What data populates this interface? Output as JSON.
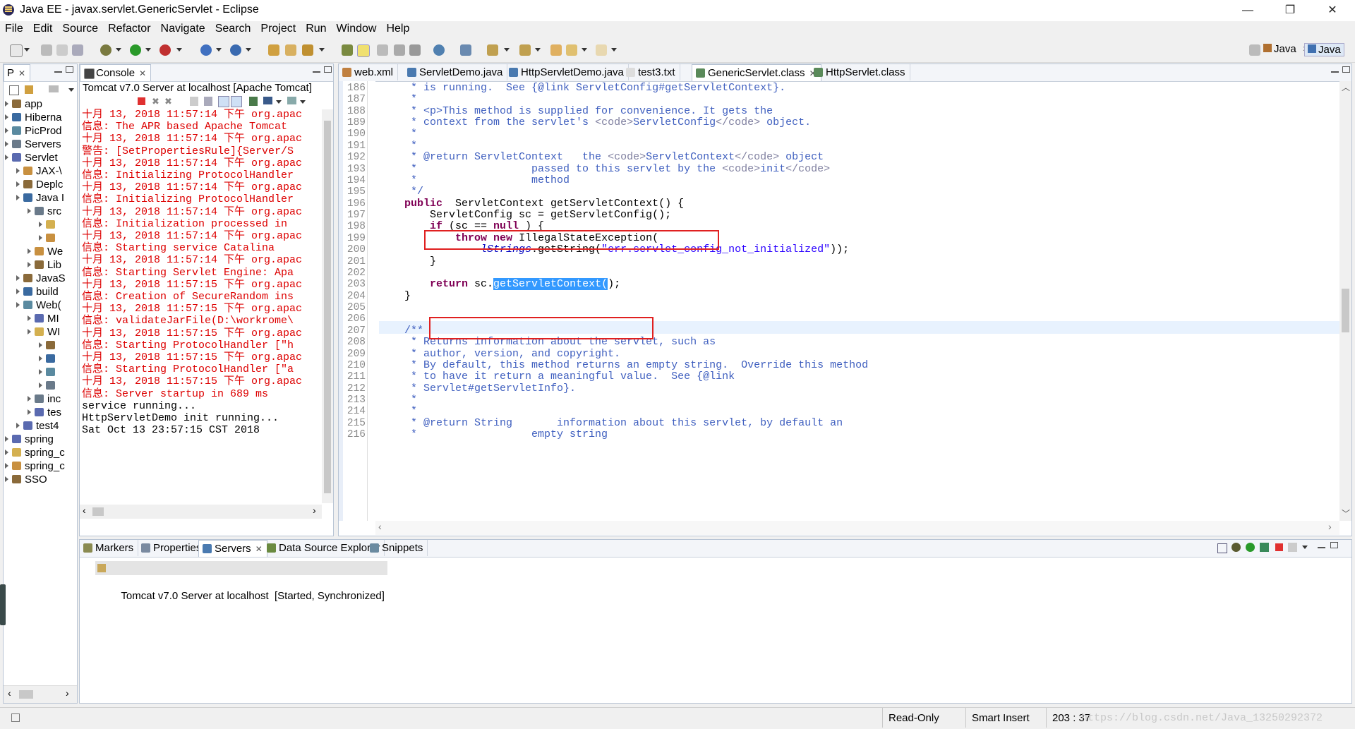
{
  "window": {
    "title": "Java EE - javax.servlet.GenericServlet - Eclipse",
    "min": "—",
    "max": "❐",
    "close": "✕"
  },
  "menu": [
    "File",
    "Edit",
    "Source",
    "Refactor",
    "Navigate",
    "Search",
    "Project",
    "Run",
    "Window",
    "Help"
  ],
  "perspectives": {
    "java": "Java",
    "java_active": "Java"
  },
  "project_explorer": {
    "tab": "P",
    "items": [
      {
        "label": "app",
        "level": 0
      },
      {
        "label": "Hiberna",
        "level": 0
      },
      {
        "label": "PicProd",
        "level": 0
      },
      {
        "label": "Servers",
        "level": 0
      },
      {
        "label": "Servlet",
        "level": 0
      },
      {
        "label": "JAX-\\",
        "level": 1
      },
      {
        "label": "Deplc",
        "level": 1
      },
      {
        "label": "Java I",
        "level": 1
      },
      {
        "label": "src",
        "level": 2
      },
      {
        "label": "",
        "level": 3
      },
      {
        "label": "",
        "level": 3
      },
      {
        "label": "We",
        "level": 2
      },
      {
        "label": "Lib",
        "level": 2
      },
      {
        "label": "JavaS",
        "level": 1
      },
      {
        "label": "build",
        "level": 1
      },
      {
        "label": "Web(",
        "level": 1
      },
      {
        "label": "MI",
        "level": 2
      },
      {
        "label": "WI",
        "level": 2
      },
      {
        "label": "",
        "level": 3
      },
      {
        "label": "",
        "level": 3
      },
      {
        "label": "",
        "level": 3
      },
      {
        "label": "",
        "level": 3
      },
      {
        "label": "inc",
        "level": 2
      },
      {
        "label": "tes",
        "level": 2
      },
      {
        "label": "test4",
        "level": 1
      },
      {
        "label": "spring",
        "level": 0
      },
      {
        "label": "spring_c",
        "level": 0
      },
      {
        "label": "spring_c",
        "level": 0
      },
      {
        "label": "SSO",
        "level": 0
      }
    ]
  },
  "console": {
    "tab": "Console",
    "header": "Tomcat v7.0 Server at localhost [Apache Tomcat]",
    "lines": [
      {
        "t": "十月 13, 2018 11:57:14 下午 org.apac",
        "c": "red"
      },
      {
        "t": "信息: The APR based Apache Tomcat",
        "c": "red"
      },
      {
        "t": "十月 13, 2018 11:57:14 下午 org.apac",
        "c": "red"
      },
      {
        "t": "警告: [SetPropertiesRule]{Server/S",
        "c": "red"
      },
      {
        "t": "十月 13, 2018 11:57:14 下午 org.apac",
        "c": "red"
      },
      {
        "t": "信息: Initializing ProtocolHandler",
        "c": "red"
      },
      {
        "t": "十月 13, 2018 11:57:14 下午 org.apac",
        "c": "red"
      },
      {
        "t": "信息: Initializing ProtocolHandler",
        "c": "red"
      },
      {
        "t": "十月 13, 2018 11:57:14 下午 org.apac",
        "c": "red"
      },
      {
        "t": "信息: Initialization processed in",
        "c": "red"
      },
      {
        "t": "十月 13, 2018 11:57:14 下午 org.apac",
        "c": "red"
      },
      {
        "t": "信息: Starting service Catalina",
        "c": "red"
      },
      {
        "t": "十月 13, 2018 11:57:14 下午 org.apac",
        "c": "red"
      },
      {
        "t": "信息: Starting Servlet Engine: Apa",
        "c": "red"
      },
      {
        "t": "十月 13, 2018 11:57:15 下午 org.apac",
        "c": "red"
      },
      {
        "t": "信息: Creation of SecureRandom ins",
        "c": "red"
      },
      {
        "t": "十月 13, 2018 11:57:15 下午 org.apac",
        "c": "red"
      },
      {
        "t": "信息: validateJarFile(D:\\workrome\\",
        "c": "red"
      },
      {
        "t": "十月 13, 2018 11:57:15 下午 org.apac",
        "c": "red"
      },
      {
        "t": "信息: Starting ProtocolHandler [\"h",
        "c": "red"
      },
      {
        "t": "十月 13, 2018 11:57:15 下午 org.apac",
        "c": "red"
      },
      {
        "t": "信息: Starting ProtocolHandler [\"a",
        "c": "red"
      },
      {
        "t": "十月 13, 2018 11:57:15 下午 org.apac",
        "c": "red"
      },
      {
        "t": "信息: Server startup in 689 ms",
        "c": "red"
      },
      {
        "t": "service running...",
        "c": "black"
      },
      {
        "t": "HttpServletDemo init running...",
        "c": "black"
      },
      {
        "t": "Sat Oct 13 23:57:15 CST 2018",
        "c": "black"
      }
    ]
  },
  "editor": {
    "tabs": [
      "web.xml",
      "ServletDemo.java",
      "HttpServletDemo.java",
      "test3.txt",
      "GenericServlet.class",
      "HttpServlet.class"
    ],
    "active_tab": 4,
    "lines": [
      {
        "n": "186",
        "segs": [
          [
            "cm",
            "     * is running.  See {@link ServletConfig#getServletContext}."
          ]
        ]
      },
      {
        "n": "187",
        "segs": [
          [
            "cm",
            "     *"
          ]
        ]
      },
      {
        "n": "188",
        "segs": [
          [
            "cm",
            "     * <p>This method is supplied for convenience. It gets the"
          ]
        ]
      },
      {
        "n": "189",
        "segs": [
          [
            "cm",
            "     * context from the servlet's "
          ],
          [
            "tag",
            "<code>"
          ],
          [
            "cm",
            "ServletConfig"
          ],
          [
            "tag",
            "</code>"
          ],
          [
            "cm",
            " object."
          ]
        ]
      },
      {
        "n": "190",
        "segs": [
          [
            "cm",
            "     *"
          ]
        ]
      },
      {
        "n": "191",
        "segs": [
          [
            "cm",
            "     *"
          ]
        ]
      },
      {
        "n": "192",
        "segs": [
          [
            "cm",
            "     * @return ServletContext   the "
          ],
          [
            "tag",
            "<code>"
          ],
          [
            "cm",
            "ServletContext"
          ],
          [
            "tag",
            "</code>"
          ],
          [
            "cm",
            " object"
          ]
        ]
      },
      {
        "n": "193",
        "segs": [
          [
            "cm",
            "     *                  passed to this servlet by the "
          ],
          [
            "tag",
            "<code>"
          ],
          [
            "cm",
            "init"
          ],
          [
            "tag",
            "</code>"
          ]
        ]
      },
      {
        "n": "194",
        "segs": [
          [
            "cm",
            "     *                  method"
          ]
        ]
      },
      {
        "n": "195",
        "segs": [
          [
            "cm",
            "     */"
          ]
        ]
      },
      {
        "n": "196",
        "segs": [
          [
            "kw",
            "    public"
          ],
          [
            "",
            "  ServletContext getServletContext() {"
          ]
        ]
      },
      {
        "n": "197",
        "segs": [
          [
            "",
            "        ServletConfig sc = getServletConfig();"
          ]
        ]
      },
      {
        "n": "198",
        "segs": [
          [
            "kw",
            "        if"
          ],
          [
            "",
            " (sc == "
          ],
          [
            "kw",
            "null"
          ],
          [
            "",
            " ) {"
          ]
        ]
      },
      {
        "n": "199",
        "segs": [
          [
            "kw",
            "            throw"
          ],
          [
            "",
            " "
          ],
          [
            "kw",
            "new"
          ],
          [
            "",
            " IllegalStateException("
          ]
        ]
      },
      {
        "n": "200",
        "segs": [
          [
            "fld",
            "                lStrings"
          ],
          [
            "",
            ".getString("
          ],
          [
            "str",
            "\"err.servlet_config_not_initialized\""
          ],
          [
            "",
            "));"
          ]
        ]
      },
      {
        "n": "201",
        "segs": [
          [
            "",
            "        }"
          ]
        ]
      },
      {
        "n": "202",
        "segs": [
          [
            "",
            ""
          ]
        ]
      },
      {
        "n": "203",
        "segs": [
          [
            "kw",
            "        return"
          ],
          [
            "",
            " sc."
          ],
          [
            "sel",
            "getServletContext("
          ],
          [
            "",
            ");"
          ]
        ]
      },
      {
        "n": "204",
        "segs": [
          [
            "",
            "    }"
          ]
        ]
      },
      {
        "n": "205",
        "segs": [
          [
            "",
            ""
          ]
        ]
      },
      {
        "n": "206",
        "segs": [
          [
            "",
            ""
          ]
        ]
      },
      {
        "n": "207",
        "segs": [
          [
            "cm",
            "    /**"
          ]
        ]
      },
      {
        "n": "208",
        "segs": [
          [
            "cm",
            "     * Returns information about the servlet, such as"
          ]
        ]
      },
      {
        "n": "209",
        "segs": [
          [
            "cm",
            "     * author, version, and copyright."
          ]
        ]
      },
      {
        "n": "210",
        "segs": [
          [
            "cm",
            "     * By default, this method returns an empty string.  Override this method"
          ]
        ]
      },
      {
        "n": "211",
        "segs": [
          [
            "cm",
            "     * to have it return a meaningful value.  See {@link"
          ]
        ]
      },
      {
        "n": "212",
        "segs": [
          [
            "cm",
            "     * Servlet#getServletInfo}."
          ]
        ]
      },
      {
        "n": "213",
        "segs": [
          [
            "cm",
            "     *"
          ]
        ]
      },
      {
        "n": "214",
        "segs": [
          [
            "cm",
            "     *"
          ]
        ]
      },
      {
        "n": "215",
        "segs": [
          [
            "cm",
            "     * @return String       information about this servlet, by default an"
          ]
        ]
      },
      {
        "n": "216",
        "segs": [
          [
            "cm",
            "     *                  empty string"
          ]
        ]
      }
    ]
  },
  "bottom": {
    "tabs": [
      "Markers",
      "Properties",
      "Servers",
      "Data Source Explorer",
      "Snippets"
    ],
    "active_tab": 2,
    "server_row": "Tomcat v7.0 Server at localhost  [Started, Synchronized]"
  },
  "status": {
    "read_only": "Read-Only",
    "insert_mode": "Smart Insert",
    "position": "203 : 37",
    "watermark": "https://blog.csdn.net/Java_13250292372"
  }
}
